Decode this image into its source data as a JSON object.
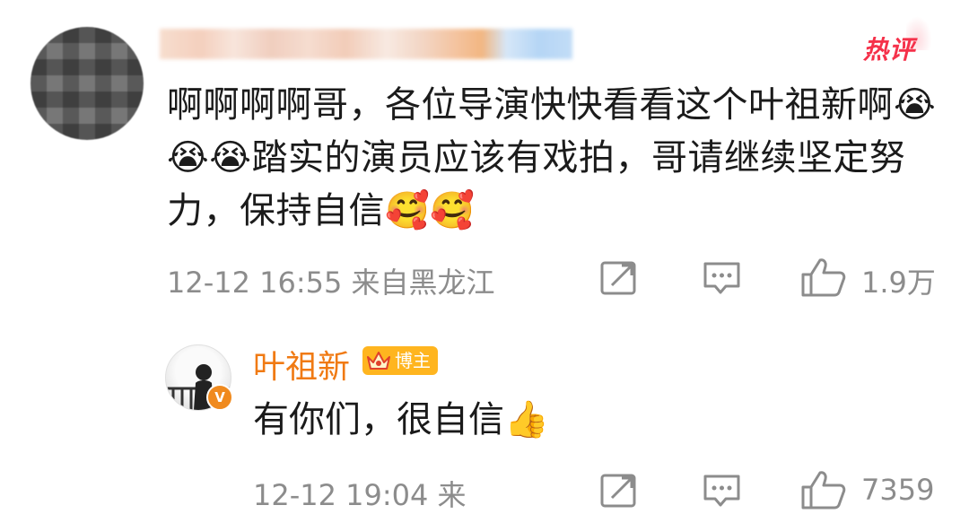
{
  "hot_badge": "热评",
  "top_comment": {
    "text": "啊啊啊啊哥，各位导演快快看看这个叶祖新啊😭😭😭踏实的演员应该有戏拍，哥请继续坚定努力，保持自信🥰🥰",
    "timestamp": "12-12 16:55",
    "location": "来自黑龙江",
    "likes": "1.9万"
  },
  "reply": {
    "author": "叶祖新",
    "badge": "博主",
    "verified_mark": "V",
    "text": "有你们，很自信👍",
    "timestamp": "12-12 19:04",
    "location": "来",
    "likes": "7359"
  },
  "icons": {
    "share": "share-icon",
    "comment": "comment-icon",
    "like": "thumbs-up-icon",
    "crown": "crown-icon",
    "verified": "verified-v-icon"
  },
  "colors": {
    "hot": "#f5314a",
    "author_name": "#f07a13",
    "badge_bg": "#ffb51f",
    "meta_text": "#8c8c8c"
  }
}
